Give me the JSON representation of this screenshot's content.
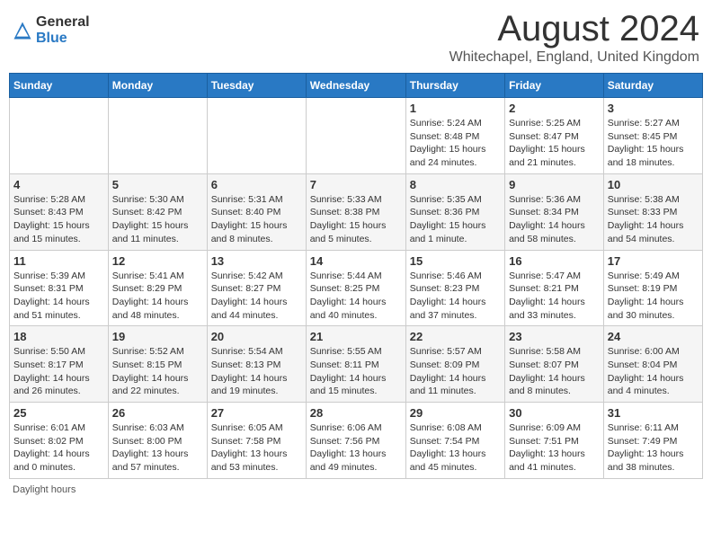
{
  "header": {
    "logo_general": "General",
    "logo_blue": "Blue",
    "month_title": "August 2024",
    "location": "Whitechapel, England, United Kingdom"
  },
  "weekdays": [
    "Sunday",
    "Monday",
    "Tuesday",
    "Wednesday",
    "Thursday",
    "Friday",
    "Saturday"
  ],
  "weeks": [
    [
      {
        "day": "",
        "sunrise": "",
        "sunset": "",
        "daylight": ""
      },
      {
        "day": "",
        "sunrise": "",
        "sunset": "",
        "daylight": ""
      },
      {
        "day": "",
        "sunrise": "",
        "sunset": "",
        "daylight": ""
      },
      {
        "day": "",
        "sunrise": "",
        "sunset": "",
        "daylight": ""
      },
      {
        "day": "1",
        "sunrise": "Sunrise: 5:24 AM",
        "sunset": "Sunset: 8:48 PM",
        "daylight": "Daylight: 15 hours and 24 minutes."
      },
      {
        "day": "2",
        "sunrise": "Sunrise: 5:25 AM",
        "sunset": "Sunset: 8:47 PM",
        "daylight": "Daylight: 15 hours and 21 minutes."
      },
      {
        "day": "3",
        "sunrise": "Sunrise: 5:27 AM",
        "sunset": "Sunset: 8:45 PM",
        "daylight": "Daylight: 15 hours and 18 minutes."
      }
    ],
    [
      {
        "day": "4",
        "sunrise": "Sunrise: 5:28 AM",
        "sunset": "Sunset: 8:43 PM",
        "daylight": "Daylight: 15 hours and 15 minutes."
      },
      {
        "day": "5",
        "sunrise": "Sunrise: 5:30 AM",
        "sunset": "Sunset: 8:42 PM",
        "daylight": "Daylight: 15 hours and 11 minutes."
      },
      {
        "day": "6",
        "sunrise": "Sunrise: 5:31 AM",
        "sunset": "Sunset: 8:40 PM",
        "daylight": "Daylight: 15 hours and 8 minutes."
      },
      {
        "day": "7",
        "sunrise": "Sunrise: 5:33 AM",
        "sunset": "Sunset: 8:38 PM",
        "daylight": "Daylight: 15 hours and 5 minutes."
      },
      {
        "day": "8",
        "sunrise": "Sunrise: 5:35 AM",
        "sunset": "Sunset: 8:36 PM",
        "daylight": "Daylight: 15 hours and 1 minute."
      },
      {
        "day": "9",
        "sunrise": "Sunrise: 5:36 AM",
        "sunset": "Sunset: 8:34 PM",
        "daylight": "Daylight: 14 hours and 58 minutes."
      },
      {
        "day": "10",
        "sunrise": "Sunrise: 5:38 AM",
        "sunset": "Sunset: 8:33 PM",
        "daylight": "Daylight: 14 hours and 54 minutes."
      }
    ],
    [
      {
        "day": "11",
        "sunrise": "Sunrise: 5:39 AM",
        "sunset": "Sunset: 8:31 PM",
        "daylight": "Daylight: 14 hours and 51 minutes."
      },
      {
        "day": "12",
        "sunrise": "Sunrise: 5:41 AM",
        "sunset": "Sunset: 8:29 PM",
        "daylight": "Daylight: 14 hours and 48 minutes."
      },
      {
        "day": "13",
        "sunrise": "Sunrise: 5:42 AM",
        "sunset": "Sunset: 8:27 PM",
        "daylight": "Daylight: 14 hours and 44 minutes."
      },
      {
        "day": "14",
        "sunrise": "Sunrise: 5:44 AM",
        "sunset": "Sunset: 8:25 PM",
        "daylight": "Daylight: 14 hours and 40 minutes."
      },
      {
        "day": "15",
        "sunrise": "Sunrise: 5:46 AM",
        "sunset": "Sunset: 8:23 PM",
        "daylight": "Daylight: 14 hours and 37 minutes."
      },
      {
        "day": "16",
        "sunrise": "Sunrise: 5:47 AM",
        "sunset": "Sunset: 8:21 PM",
        "daylight": "Daylight: 14 hours and 33 minutes."
      },
      {
        "day": "17",
        "sunrise": "Sunrise: 5:49 AM",
        "sunset": "Sunset: 8:19 PM",
        "daylight": "Daylight: 14 hours and 30 minutes."
      }
    ],
    [
      {
        "day": "18",
        "sunrise": "Sunrise: 5:50 AM",
        "sunset": "Sunset: 8:17 PM",
        "daylight": "Daylight: 14 hours and 26 minutes."
      },
      {
        "day": "19",
        "sunrise": "Sunrise: 5:52 AM",
        "sunset": "Sunset: 8:15 PM",
        "daylight": "Daylight: 14 hours and 22 minutes."
      },
      {
        "day": "20",
        "sunrise": "Sunrise: 5:54 AM",
        "sunset": "Sunset: 8:13 PM",
        "daylight": "Daylight: 14 hours and 19 minutes."
      },
      {
        "day": "21",
        "sunrise": "Sunrise: 5:55 AM",
        "sunset": "Sunset: 8:11 PM",
        "daylight": "Daylight: 14 hours and 15 minutes."
      },
      {
        "day": "22",
        "sunrise": "Sunrise: 5:57 AM",
        "sunset": "Sunset: 8:09 PM",
        "daylight": "Daylight: 14 hours and 11 minutes."
      },
      {
        "day": "23",
        "sunrise": "Sunrise: 5:58 AM",
        "sunset": "Sunset: 8:07 PM",
        "daylight": "Daylight: 14 hours and 8 minutes."
      },
      {
        "day": "24",
        "sunrise": "Sunrise: 6:00 AM",
        "sunset": "Sunset: 8:04 PM",
        "daylight": "Daylight: 14 hours and 4 minutes."
      }
    ],
    [
      {
        "day": "25",
        "sunrise": "Sunrise: 6:01 AM",
        "sunset": "Sunset: 8:02 PM",
        "daylight": "Daylight: 14 hours and 0 minutes."
      },
      {
        "day": "26",
        "sunrise": "Sunrise: 6:03 AM",
        "sunset": "Sunset: 8:00 PM",
        "daylight": "Daylight: 13 hours and 57 minutes."
      },
      {
        "day": "27",
        "sunrise": "Sunrise: 6:05 AM",
        "sunset": "Sunset: 7:58 PM",
        "daylight": "Daylight: 13 hours and 53 minutes."
      },
      {
        "day": "28",
        "sunrise": "Sunrise: 6:06 AM",
        "sunset": "Sunset: 7:56 PM",
        "daylight": "Daylight: 13 hours and 49 minutes."
      },
      {
        "day": "29",
        "sunrise": "Sunrise: 6:08 AM",
        "sunset": "Sunset: 7:54 PM",
        "daylight": "Daylight: 13 hours and 45 minutes."
      },
      {
        "day": "30",
        "sunrise": "Sunrise: 6:09 AM",
        "sunset": "Sunset: 7:51 PM",
        "daylight": "Daylight: 13 hours and 41 minutes."
      },
      {
        "day": "31",
        "sunrise": "Sunrise: 6:11 AM",
        "sunset": "Sunset: 7:49 PM",
        "daylight": "Daylight: 13 hours and 38 minutes."
      }
    ]
  ],
  "footer": {
    "note": "Daylight hours"
  }
}
